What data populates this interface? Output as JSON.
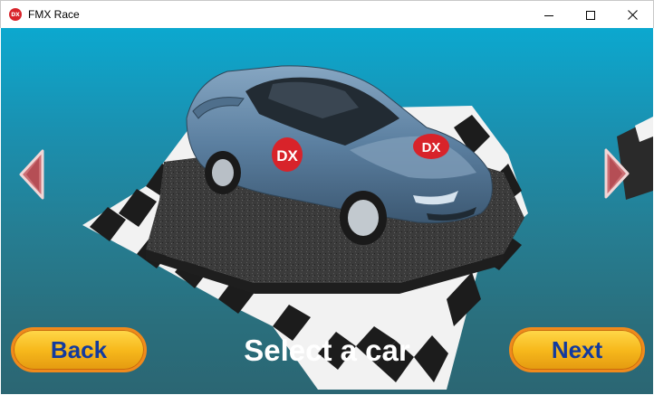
{
  "window": {
    "title": "FMX Race",
    "app_icon_text": "DX"
  },
  "car": {
    "badge_text": "DX",
    "body_color": "#5b7fa0"
  },
  "controls": {
    "back_label": "Back",
    "next_label": "Next",
    "heading": "Select a car"
  },
  "colors": {
    "sky_top": "#0ca8cf",
    "sky_bottom": "#2b6673",
    "button_fill": "#f7b91c",
    "button_border": "#f08a1c",
    "button_text": "#133a9e",
    "badge_red": "#d8232a"
  }
}
